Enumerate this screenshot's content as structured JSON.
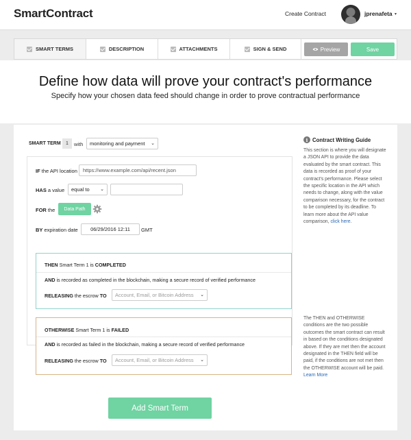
{
  "header": {
    "logo": "SmartContract",
    "create_link": "Create Contract",
    "username": "jprenafeta",
    "caret": "▾"
  },
  "tabs": [
    {
      "label": "SMART TERMS",
      "active": true
    },
    {
      "label": "DESCRIPTION",
      "active": false
    },
    {
      "label": "ATTACHMENTS",
      "active": false
    },
    {
      "label": "SIGN & SEND",
      "active": false
    }
  ],
  "actions": {
    "preview": "Preview",
    "save": "Save"
  },
  "hero": {
    "title": "Define how data will prove your contract's performance",
    "subtitle": "Specify how your chosen data feed should change in order to prove contractual performance"
  },
  "term": {
    "label": "SMART TERM",
    "number": "1",
    "with": "with",
    "type_value": "monitoring and payment",
    "if_bold": "IF",
    "if_rest": " the API location",
    "api_value": "https://www.example.com/api/recent.json",
    "has_bold": "HAS",
    "has_rest": " a value",
    "comparison": "equal to",
    "compare_value": "",
    "for_bold": "FOR",
    "for_rest": " the",
    "data_path": "Data Path",
    "by_bold": "BY",
    "by_rest": " expiration date",
    "date_value": "06/29/2016 12:11",
    "tz": "GMT"
  },
  "then_box": {
    "head_bold": "THEN",
    "head_rest": " Smart Term 1 is ",
    "head_state": "COMPLETED",
    "and_bold": "AND",
    "and_rest": " is recorded as completed in the blockchain, making a secure record of verified performance",
    "rel_bold": "RELEASING",
    "rel_rest": " the escrow ",
    "rel_to": "TO",
    "placeholder": "Account, Email, or Bitcoin Address"
  },
  "else_box": {
    "head_bold": "OTHERWISE",
    "head_rest": " Smart Term 1 is ",
    "head_state": "FAILED",
    "and_bold": "AND",
    "and_rest": " is recorded as failed in the blockchain, making a secure record of verified performance",
    "rel_bold": "RELEASING",
    "rel_rest": " the escrow ",
    "rel_to": "TO",
    "placeholder": "Account, Email, or Bitcoin Address"
  },
  "add_button": "Add Smart Term",
  "guide": {
    "title": "Contract Writing Guide",
    "text": "This section is where you will designate a JSON API to provide the data evaluated by the smart contract. This data is recorded as proof of your contract's performance. Please select the specific location in the API which needs to change, along with the value comparison necessary, for the contract to be completed by its deadline. To learn more about the API value comparison, ",
    "link": "click here",
    "link_end": ".",
    "text2": "The THEN and OTHERWISE conditions are the two possible outcomes the smart contract can result in based on the conditions designated above. If they are met then the account designated in the THEN field will be paid, if the conditions are not met then the OTHERWISE account will be paid.",
    "link2": "Learn More"
  },
  "colors": {
    "accent_green": "#6fd3a2",
    "then_border": "#8fd1cb",
    "else_border": "#d9b383",
    "link": "#2a67b1"
  }
}
